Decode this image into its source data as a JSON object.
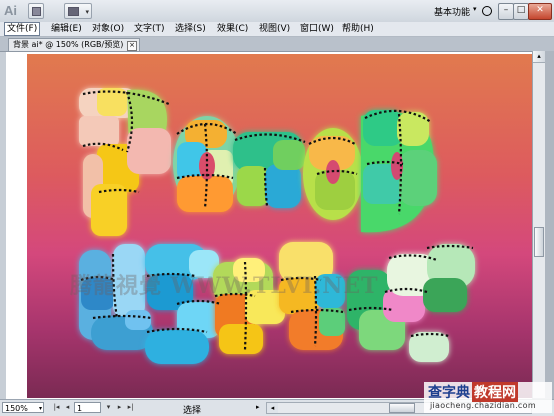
{
  "app": {
    "logo": "Ai",
    "workspace_label": "基本功能",
    "workspace_dropdown": "▾",
    "win_min": "–",
    "win_max": "□",
    "win_close": "✕"
  },
  "menu": [
    {
      "label": "文件(F)"
    },
    {
      "label": "编辑(E)"
    },
    {
      "label": "对象(O)"
    },
    {
      "label": "文字(T)"
    },
    {
      "label": "选择(S)"
    },
    {
      "label": "效果(C)"
    },
    {
      "label": "视图(V)"
    },
    {
      "label": "窗口(W)"
    },
    {
      "label": "帮助(H)"
    }
  ],
  "document_tab": {
    "title": "背景  ai* @ 150% (RGB/预览)",
    "close": "×"
  },
  "canvas": {
    "watermark": "腾龍視覺 WWW.TLVI.NET",
    "gradient_colors": [
      "#e17a4e",
      "#dd5b5e",
      "#d4487c",
      "#a7356d",
      "#7a2a53"
    ]
  },
  "statusbar": {
    "zoom": "150%",
    "zoom_dd": "▾",
    "page": "1",
    "nav_first": "|◂",
    "nav_prev": "◂",
    "nav_next": "▸",
    "nav_last": "▸|",
    "status_text": "选择",
    "status_arrow": "▸",
    "scroll_left": "◂"
  },
  "vscroll": {
    "up": "▴"
  },
  "site": {
    "name": "查字典",
    "tag": "教程网",
    "url": "jiaocheng.chazidian.com"
  }
}
